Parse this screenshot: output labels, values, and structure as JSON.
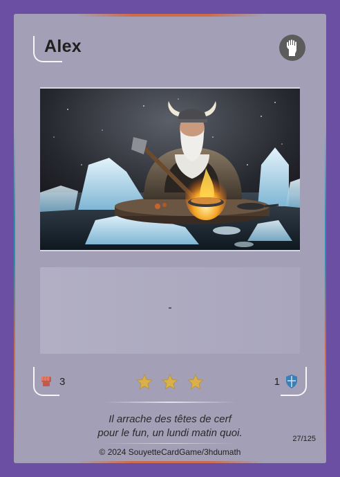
{
  "card": {
    "name": "Alex",
    "type_icon": "hand-icon",
    "ability_text": "-",
    "attack": "3",
    "defense": "1",
    "attack_icon": "fist-icon",
    "defense_icon": "shield-icon",
    "stars": 3,
    "flavor_line1": "Il arrache des têtes de cerf",
    "flavor_line2": "pour le fun, un lundi matin quoi.",
    "serial": "27/125",
    "copyright": "© 2024 SouyetteCardGame/3hdumath"
  },
  "colors": {
    "background": "#6a4fa3",
    "card": "#a39fb6",
    "accent_orange": "#d16a4a",
    "accent_blue": "#2e8fb0",
    "star": "#d9b04a",
    "attack_icon": "#c2594a",
    "defense_icon": "#3a7fb5"
  }
}
